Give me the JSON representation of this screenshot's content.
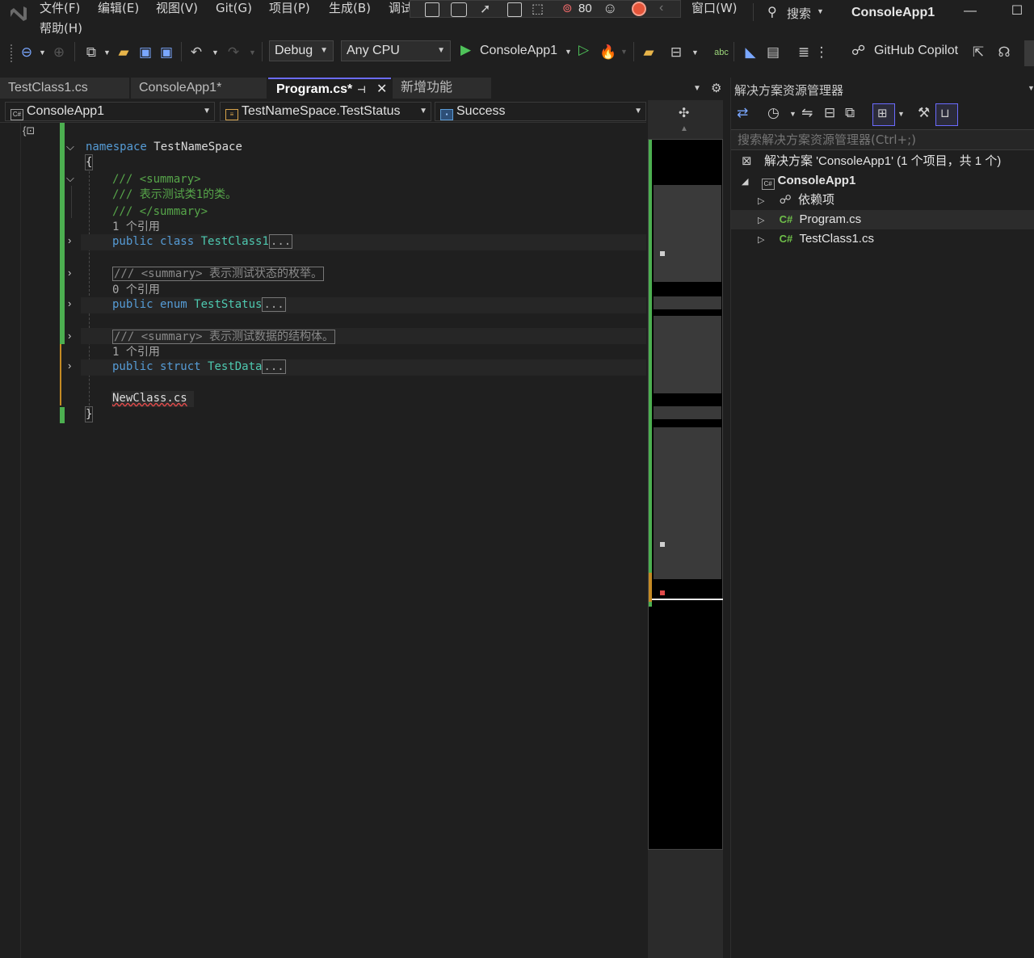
{
  "menubar": {
    "items": [
      "文件(F)",
      "编辑(E)",
      "视图(V)",
      "Git(G)",
      "项目(P)",
      "生成(B)",
      "调试"
    ],
    "window_menu": "窗口(W)",
    "help_menu": "帮助(H)",
    "search_label": "搜索",
    "app_title": "ConsoleApp1",
    "hot_reload_count": "80"
  },
  "toolbar": {
    "config": "Debug",
    "platform": "Any CPU",
    "run_target": "ConsoleApp1",
    "copilot_label": "GitHub Copilot"
  },
  "doc_tabs": {
    "tab1": "TestClass1.cs",
    "tab2": "ConsoleApp1*",
    "tab3": "Program.cs*",
    "tab4": "新增功能"
  },
  "navbar": {
    "project": "ConsoleApp1",
    "type": "TestNameSpace.TestStatus",
    "member": "Success"
  },
  "code": {
    "ns_kw": "namespace",
    "ns_name": "TestNameSpace",
    "open_brace": "{",
    "close_brace": "}",
    "summary_open": "/// <summary>",
    "summary_text": "/// 表示测试类1的类。",
    "summary_close": "/// </summary>",
    "refs_1": "1 个引用",
    "refs_0": "0 个引用",
    "refs_1b": "1 个引用",
    "class_line_kw": "public class",
    "class_name": "TestClass1",
    "enum_collapsed_comment": "/// <summary> 表示测试状态的枚举。",
    "enum_line_kw": "public enum",
    "enum_name": "TestStatus",
    "struct_collapsed_comment": "/// <summary> 表示测试数据的结构体。",
    "struct_line_kw": "public struct",
    "struct_name": "TestData",
    "ellipsis": "...",
    "error_text": "NewClass.cs"
  },
  "solution_explorer": {
    "title": "解决方案资源管理器",
    "search_placeholder": "搜索解决方案资源管理器(Ctrl+;)",
    "solution": "解决方案 'ConsoleApp1' (1 个项目，共 1 个)",
    "project": "ConsoleApp1",
    "dependencies": "依赖项",
    "file1": "Program.cs",
    "file2": "TestClass1.cs",
    "cs_badge": "C#"
  }
}
